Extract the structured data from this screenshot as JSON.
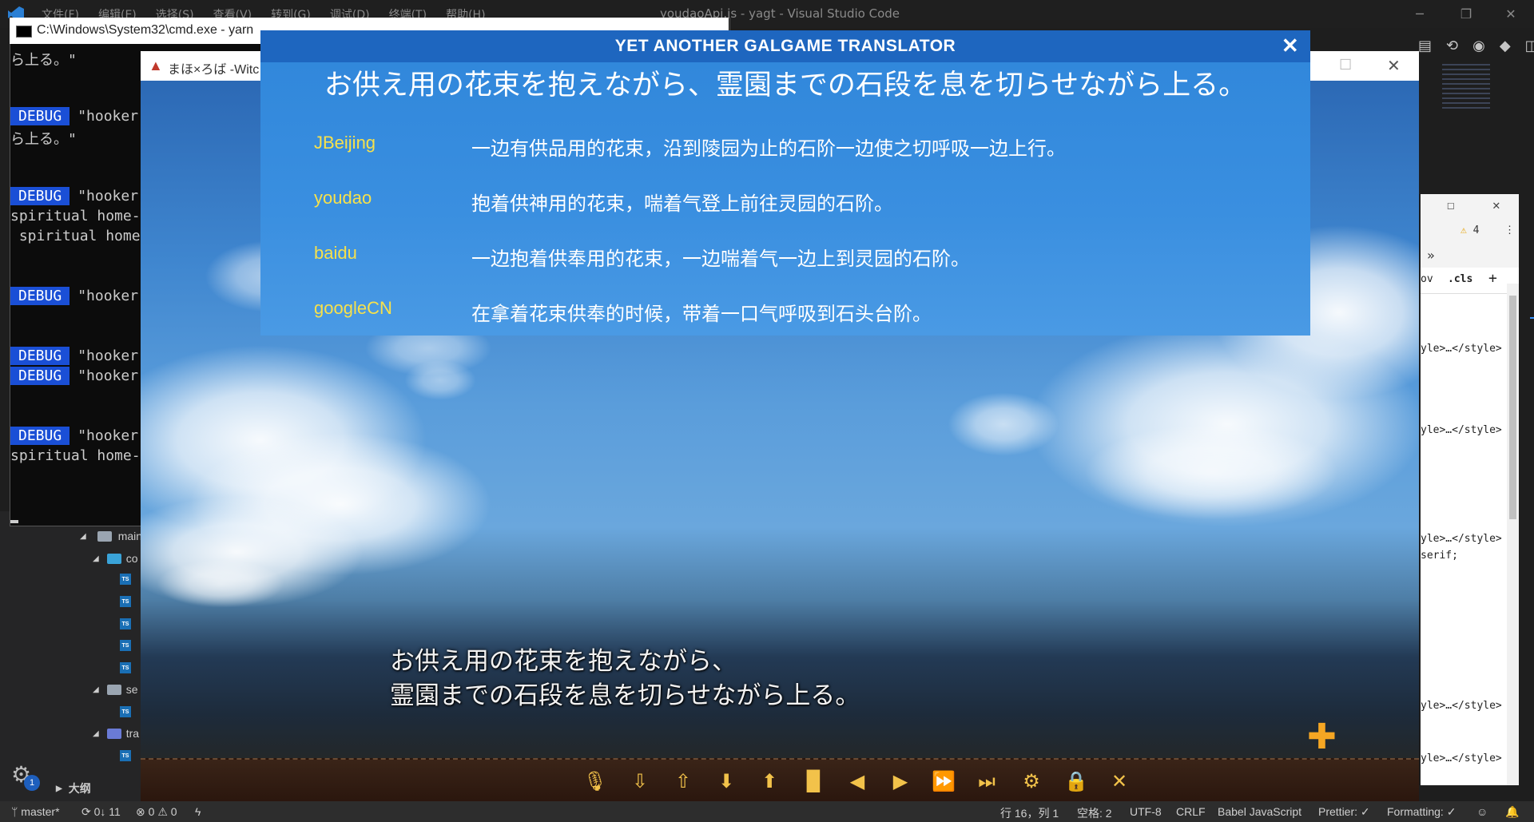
{
  "vscode": {
    "menu": [
      "文件(F)",
      "编辑(E)",
      "选择(S)",
      "查看(V)",
      "转到(G)",
      "调试(D)",
      "终端(T)",
      "帮助(H)"
    ],
    "title": "youdaoApi.js - yagt - Visual Studio Code",
    "tree": {
      "main_label": "main",
      "co_label": "co",
      "se_label": "se",
      "tra_label": "tra",
      "outline_label": "大纲"
    },
    "settings_badge": "1",
    "status": {
      "branch": "master*",
      "sync": "0↓ 11",
      "errors": "0",
      "warnings": "0",
      "position": "行 16，列 1",
      "spaces": "空格: 2",
      "encoding": "UTF-8",
      "eol": "CRLF",
      "language": "Babel JavaScript",
      "prettier": "Prettier: ✓",
      "formatting": "Formatting: ✓"
    }
  },
  "devtools": {
    "warn_count": "4",
    "cls_label": ".cls",
    "hov_label": "ov",
    "style_line": "yle>…</style>",
    "serif_line": "serif;"
  },
  "cmd": {
    "title": "C:\\Windows\\System32\\cmd.exe - yarn",
    "first_line": "ら上る。\"",
    "debug_label": "DEBUG",
    "hooker_text": "\"hooker",
    "line_ra": "ら上る。\"",
    "spiritual1": "spiritual home-",
    "spiritual2": " spiritual home",
    "spiritual3": "spiritual home-"
  },
  "game": {
    "title": "まほ×ろば -Witc",
    "dialog_line1": "お供え用の花束を抱えながら、",
    "dialog_line2": "霊園までの石段を息を切らせながら上る。",
    "plus_label": "✚"
  },
  "translator": {
    "title": "YET ANOTHER GALGAME TRANSLATOR",
    "close_label": "✕",
    "original": "お供え用の花束を抱えながら、霊園までの石段を息を切らせながら上る。",
    "results": [
      {
        "engine": "JBeijing",
        "text": "一边有供品用的花束，沿到陵园为止的石阶一边使之切呼吸一边上行。"
      },
      {
        "engine": "youdao",
        "text": "抱着供神用的花束，喘着气登上前往灵园的石阶。"
      },
      {
        "engine": "baidu",
        "text": "一边抱着供奉用的花束，一边喘着气一边上到灵园的石阶。"
      },
      {
        "engine": "googleCN",
        "text": "在拿着花束供奉的时候，带着一口气呼吸到石头台阶。"
      }
    ]
  },
  "toolbar_icons": [
    "microphone-icon",
    "quick-save-icon",
    "quick-load-icon",
    "save-icon",
    "load-icon",
    "log-icon",
    "back-icon",
    "play-icon",
    "fast-forward-icon",
    "skip-icon",
    "settings-icon",
    "lock-icon",
    "close-icon"
  ]
}
